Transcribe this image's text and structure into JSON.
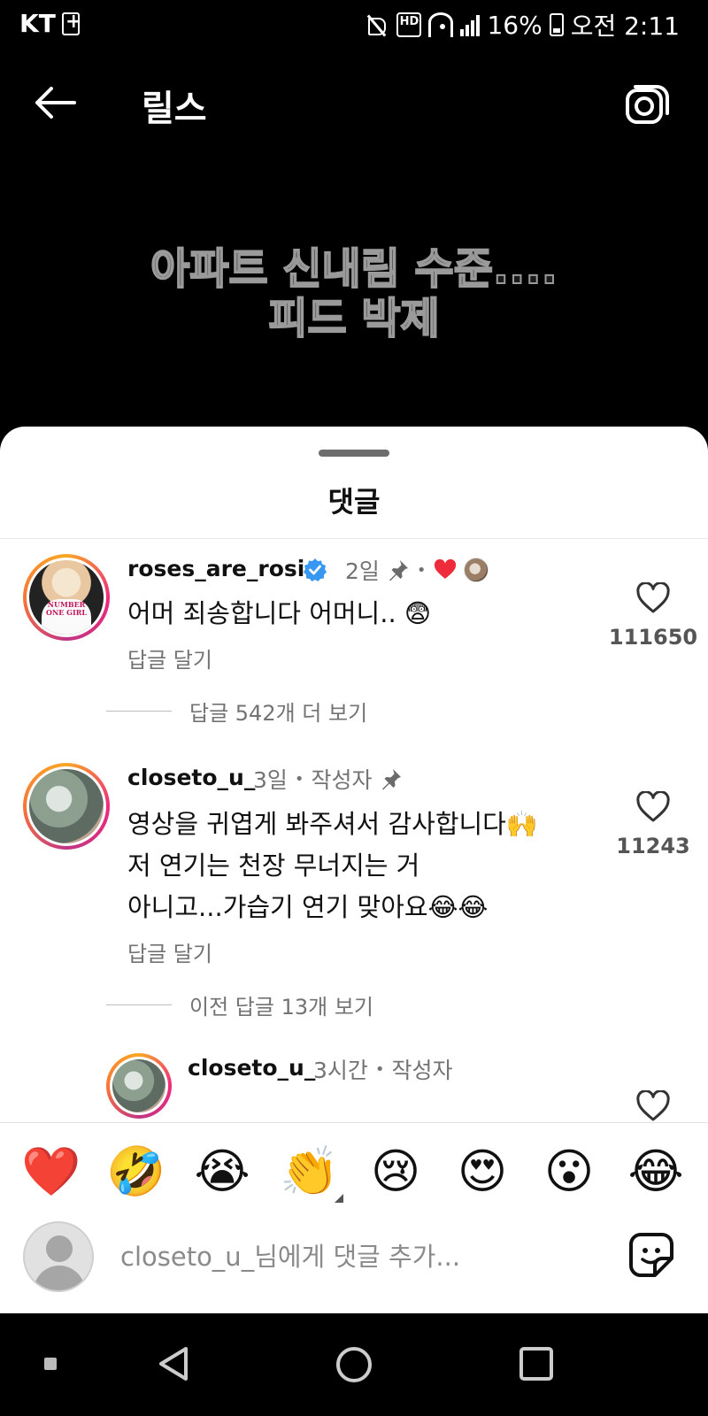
{
  "status_bar": {
    "carrier": "KT",
    "battery": "16%",
    "time": "오전 2:11",
    "icons": [
      "plus-icon",
      "mute-icon",
      "hd-icon",
      "wifi-icon",
      "signal-icon",
      "battery-icon"
    ]
  },
  "app_bar": {
    "title": "릴스",
    "back_icon": "arrow-left-icon",
    "camera_icon": "camera-icon"
  },
  "video": {
    "caption_line1": "아파트 신내림 수준....",
    "caption_line2": "피드 박제"
  },
  "sheet": {
    "title": "댓글"
  },
  "comments": [
    {
      "username": "roses_are_rosie",
      "verified": true,
      "age": "2일",
      "text": "어머 죄송합니다 어머니.. 😨",
      "reply_label": "답글 달기",
      "likes": "111650",
      "view_replies": "답글 542개 더 보기",
      "avatar_text": "NUMBER ONE GIRL"
    },
    {
      "username": "closeto_u_",
      "age": "3일",
      "author_badge": "작성자",
      "text_line1": "영상을 귀엽게 봐주셔서 감사합니다🙌",
      "text_line2": "저 연기는 천장 무너지는 거",
      "text_line3": "아니고...가습기 연기 맞아요😂😂",
      "reply_label": "답글 달기",
      "likes": "11243",
      "view_replies": "이전 답글 13개 보기"
    },
    {
      "username": "closeto_u_",
      "age": "3시간",
      "author_badge": "작성자"
    }
  ],
  "reactions": [
    "❤️",
    "🤣",
    "😭",
    "👏",
    "😢",
    "😍",
    "😮",
    "😂"
  ],
  "comment_input": {
    "placeholder": "closeto_u_님에게 댓글 추가..."
  },
  "colors": {
    "accent_blue": "#3897f0",
    "heart_red": "#ed4956",
    "text_secondary": "#737373"
  }
}
